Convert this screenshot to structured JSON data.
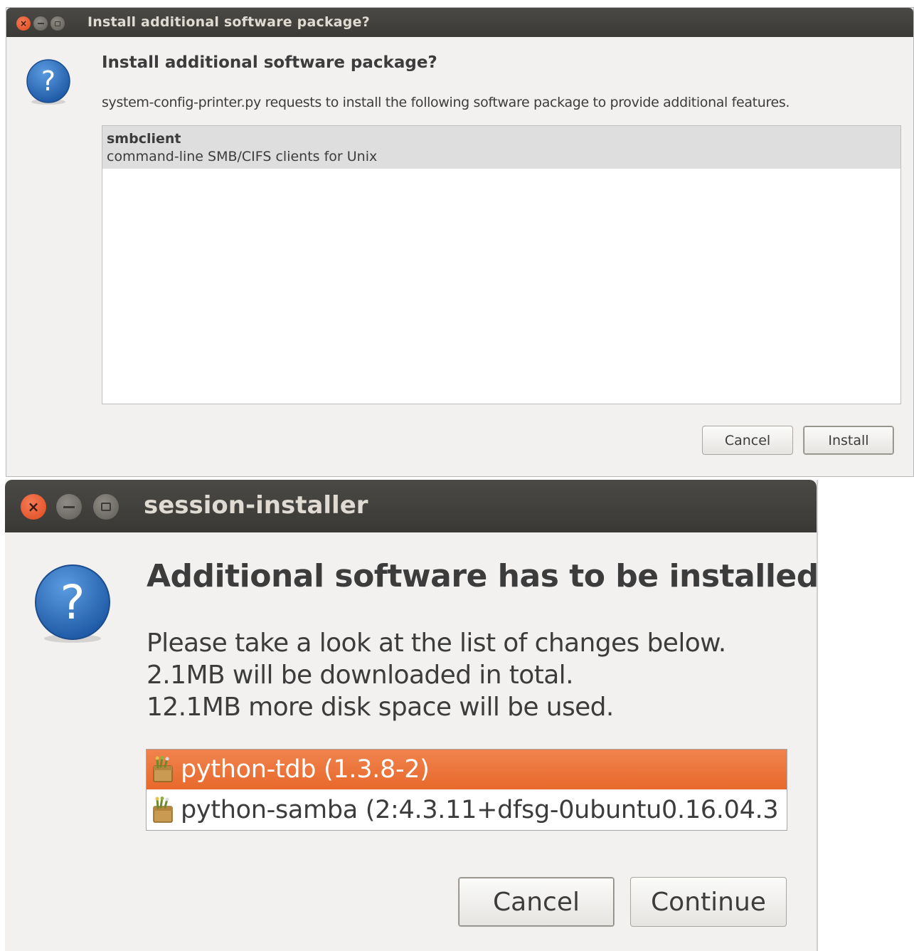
{
  "dialog1": {
    "window_title": "Install additional software package?",
    "heading": "Install additional software package?",
    "message": "system-config-printer.py requests to install the following software package to provide additional features.",
    "packages": [
      {
        "name": "smbclient",
        "description": "command-line SMB/CIFS clients for Unix"
      }
    ],
    "buttons": {
      "cancel": "Cancel",
      "install": "Install"
    },
    "icons": {
      "close": "close-icon",
      "minimize": "minimize-icon",
      "maximize": "maximize-icon",
      "question": "question-icon"
    },
    "close_glyph": "×"
  },
  "dialog2": {
    "window_title": "session-installer",
    "heading": "Additional software has to be installed",
    "lines": [
      "Please take a look at the list of changes below.",
      "2.1MB will be downloaded in total.",
      "12.1MB more disk space will be used."
    ],
    "packages": [
      {
        "label": "python-tdb (1.3.8-2)",
        "selected": true
      },
      {
        "label": "python-samba (2:4.3.11+dfsg-0ubuntu0.16.04.3",
        "selected": false
      }
    ],
    "buttons": {
      "cancel": "Cancel",
      "continue": "Continue"
    },
    "icons": {
      "close": "close-icon",
      "minimize": "minimize-icon",
      "maximize": "maximize-icon",
      "question": "question-icon",
      "package": "package-icon"
    },
    "close_glyph": "×",
    "question_glyph": "?",
    "selection_color": "#e9702f"
  }
}
